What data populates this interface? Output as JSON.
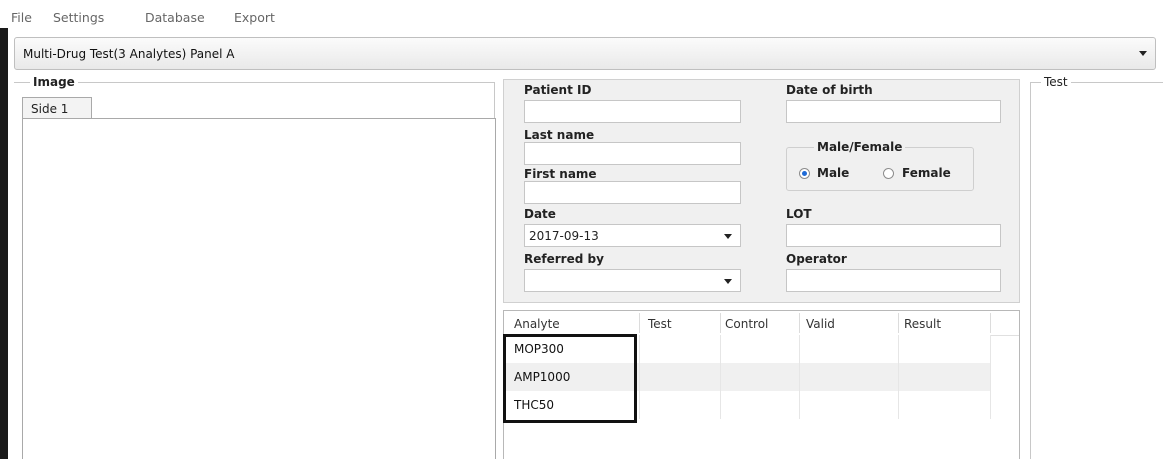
{
  "menu": [
    "File",
    "Settings",
    "Database",
    "Export"
  ],
  "panel_select": {
    "value": "Multi-Drug Test(3 Analytes) Panel A"
  },
  "image_group": {
    "title": "Image",
    "tab": "Side 1"
  },
  "form": {
    "patient_id_label": "Patient ID",
    "patient_id_value": "",
    "dob_label": "Date of birth",
    "dob_value": "",
    "last_name_label": "Last name",
    "last_name_value": "",
    "first_name_label": "First name",
    "first_name_value": "",
    "sex_group_title": "Male/Female",
    "male_label": "Male",
    "female_label": "Female",
    "selected_sex": "Male",
    "date_label": "Date",
    "date_value": "2017-09-13",
    "lot_label": "LOT",
    "lot_value": "",
    "referred_by_label": "Referred by",
    "referred_by_value": "",
    "operator_label": "Operator",
    "operator_value": ""
  },
  "grid": {
    "columns": [
      "Analyte",
      "Test",
      "Control",
      "Valid",
      "Result"
    ],
    "rows": [
      {
        "analyte": "MOP300",
        "test": "",
        "control": "",
        "valid": "",
        "result": ""
      },
      {
        "analyte": "AMP1000",
        "test": "",
        "control": "",
        "valid": "",
        "result": ""
      },
      {
        "analyte": "THC50",
        "test": "",
        "control": "",
        "valid": "",
        "result": ""
      }
    ]
  },
  "test_group": {
    "title": "Test"
  },
  "colors": {
    "selected_radio": "#1e6ad6",
    "form_bg": "#f0f0f0",
    "highlight_border": "#111111"
  }
}
